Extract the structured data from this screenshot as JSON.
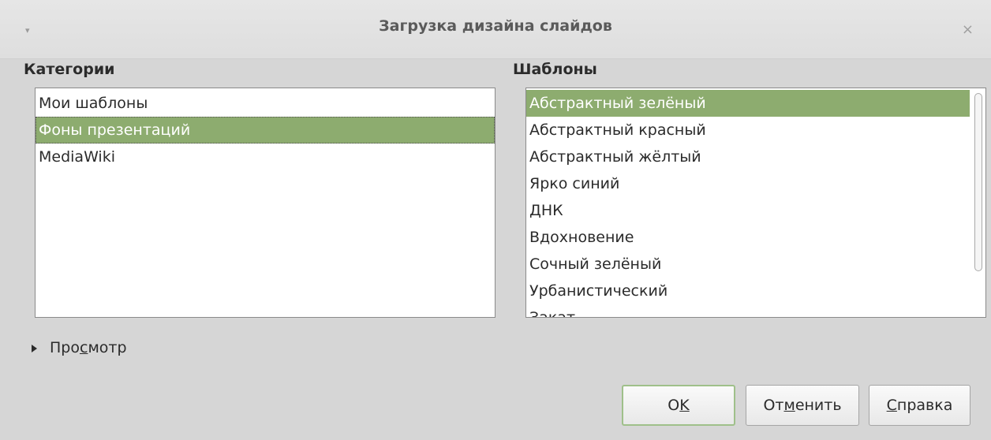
{
  "window": {
    "title": "Загрузка дизайна слайдов",
    "menu_icon": "▾",
    "close_icon": "×"
  },
  "categories": {
    "label": "Категории",
    "items": [
      "Мои шаблоны",
      "Фоны презентаций",
      "MediaWiki"
    ],
    "selected_index": 1
  },
  "templates": {
    "label": "Шаблоны",
    "items": [
      "Абстрактный зелёный",
      "Абстрактный красный",
      "Абстрактный жёлтый",
      "Ярко синий",
      "ДНК",
      "Вдохновение",
      "Сочный зелёный",
      "Урбанистический",
      "Закат"
    ],
    "selected_index": 0
  },
  "preview": {
    "pre": "Про",
    "mnemonic": "с",
    "post": "мотр"
  },
  "buttons": {
    "ok": {
      "pre": "O",
      "mnemonic": "K",
      "post": ""
    },
    "cancel": {
      "pre": "От",
      "mnemonic": "м",
      "post": "енить"
    },
    "help": {
      "pre": "",
      "mnemonic": "С",
      "post": "правка"
    }
  },
  "colors": {
    "selection": "#8dac6f",
    "default_button_border": "#9fc08a"
  }
}
